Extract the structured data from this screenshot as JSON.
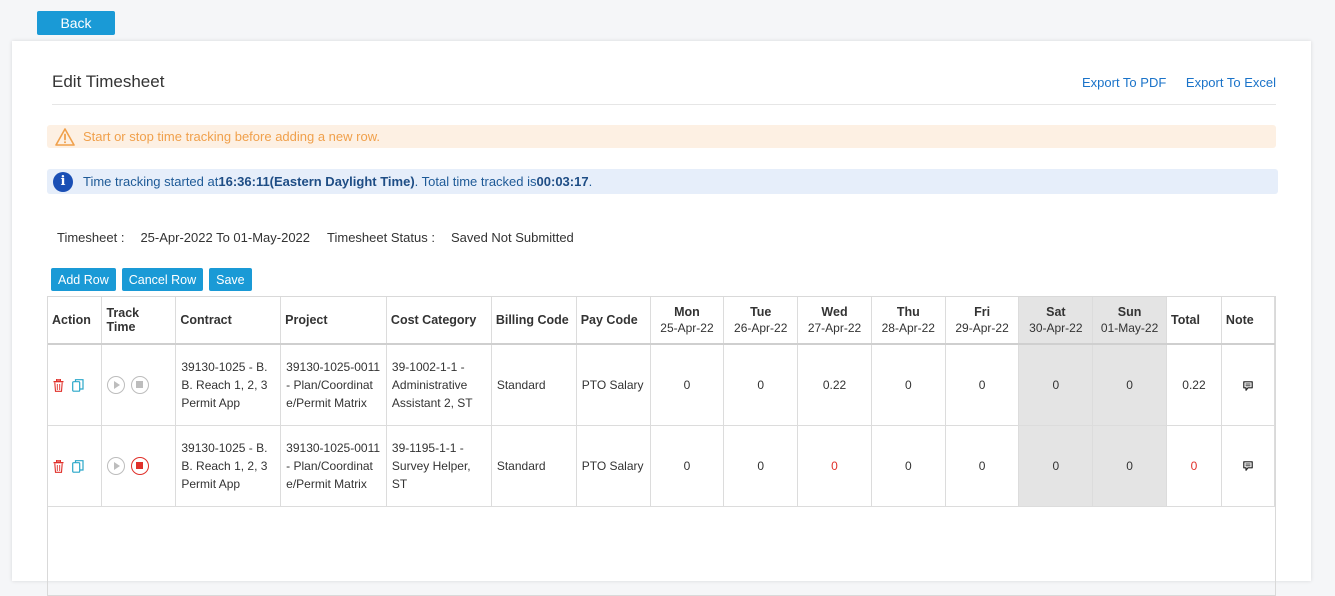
{
  "back_label": "Back",
  "header": {
    "title": "Edit Timesheet",
    "export_pdf": "Export To PDF",
    "export_excel": "Export To Excel"
  },
  "alerts": {
    "warning": "Start or stop time tracking before adding a new row.",
    "info_prefix": "Time tracking started at ",
    "info_start": "16:36:11(Eastern Daylight Time)",
    "info_middle": ". Total time tracked is ",
    "info_total": "00:03:17",
    "info_suffix": "."
  },
  "timesheet": {
    "label": "Timesheet :",
    "range": "25-Apr-2022 To 01-May-2022",
    "status_label": "Timesheet Status :",
    "status": "Saved Not Submitted"
  },
  "toolbar": {
    "add_row": "Add Row",
    "cancel_row": "Cancel Row",
    "save": "Save"
  },
  "columns": {
    "action": "Action",
    "track_time": "Track Time",
    "contract": "Contract",
    "project": "Project",
    "cost_category": "Cost Category",
    "billing_code": "Billing Code",
    "pay_code": "Pay Code",
    "total": "Total",
    "note": "Note"
  },
  "days": [
    {
      "name": "Mon",
      "date": "25-Apr-22"
    },
    {
      "name": "Tue",
      "date": "26-Apr-22"
    },
    {
      "name": "Wed",
      "date": "27-Apr-22"
    },
    {
      "name": "Thu",
      "date": "28-Apr-22"
    },
    {
      "name": "Fri",
      "date": "29-Apr-22"
    },
    {
      "name": "Sat",
      "date": "30-Apr-22"
    },
    {
      "name": "Sun",
      "date": "01-May-22"
    }
  ],
  "rows": [
    {
      "contract": "39130-1025 - B. B. Reach 1, 2, 3 Permit App",
      "project": "39130-1025-0011 - Plan/Coordinate/Permit Matrix",
      "cost_category": "39-1002-1-1 - Administrative Assistant 2, ST",
      "billing_code": "Standard",
      "pay_code": "PTO Salary",
      "hours": [
        "0",
        "0",
        "0.22",
        "0",
        "0",
        "0",
        "0"
      ],
      "total": "0.22"
    },
    {
      "contract": "39130-1025 - B. B. Reach 1, 2, 3 Permit App",
      "project": "39130-1025-0011 - Plan/Coordinate/Permit Matrix",
      "cost_category": "39-1195-1-1 - Survey Helper, ST",
      "billing_code": "Standard",
      "pay_code": "PTO Salary",
      "hours": [
        "0",
        "0",
        "0",
        "0",
        "0",
        "0",
        "0"
      ],
      "total": "0"
    }
  ],
  "colors": {
    "primary": "#1a9ad6",
    "link": "#1a73c9",
    "warning_text": "#f0a04b",
    "info_text": "#1e5a97",
    "delete_red": "#e0302a",
    "copy_teal": "#2aa7c9"
  }
}
